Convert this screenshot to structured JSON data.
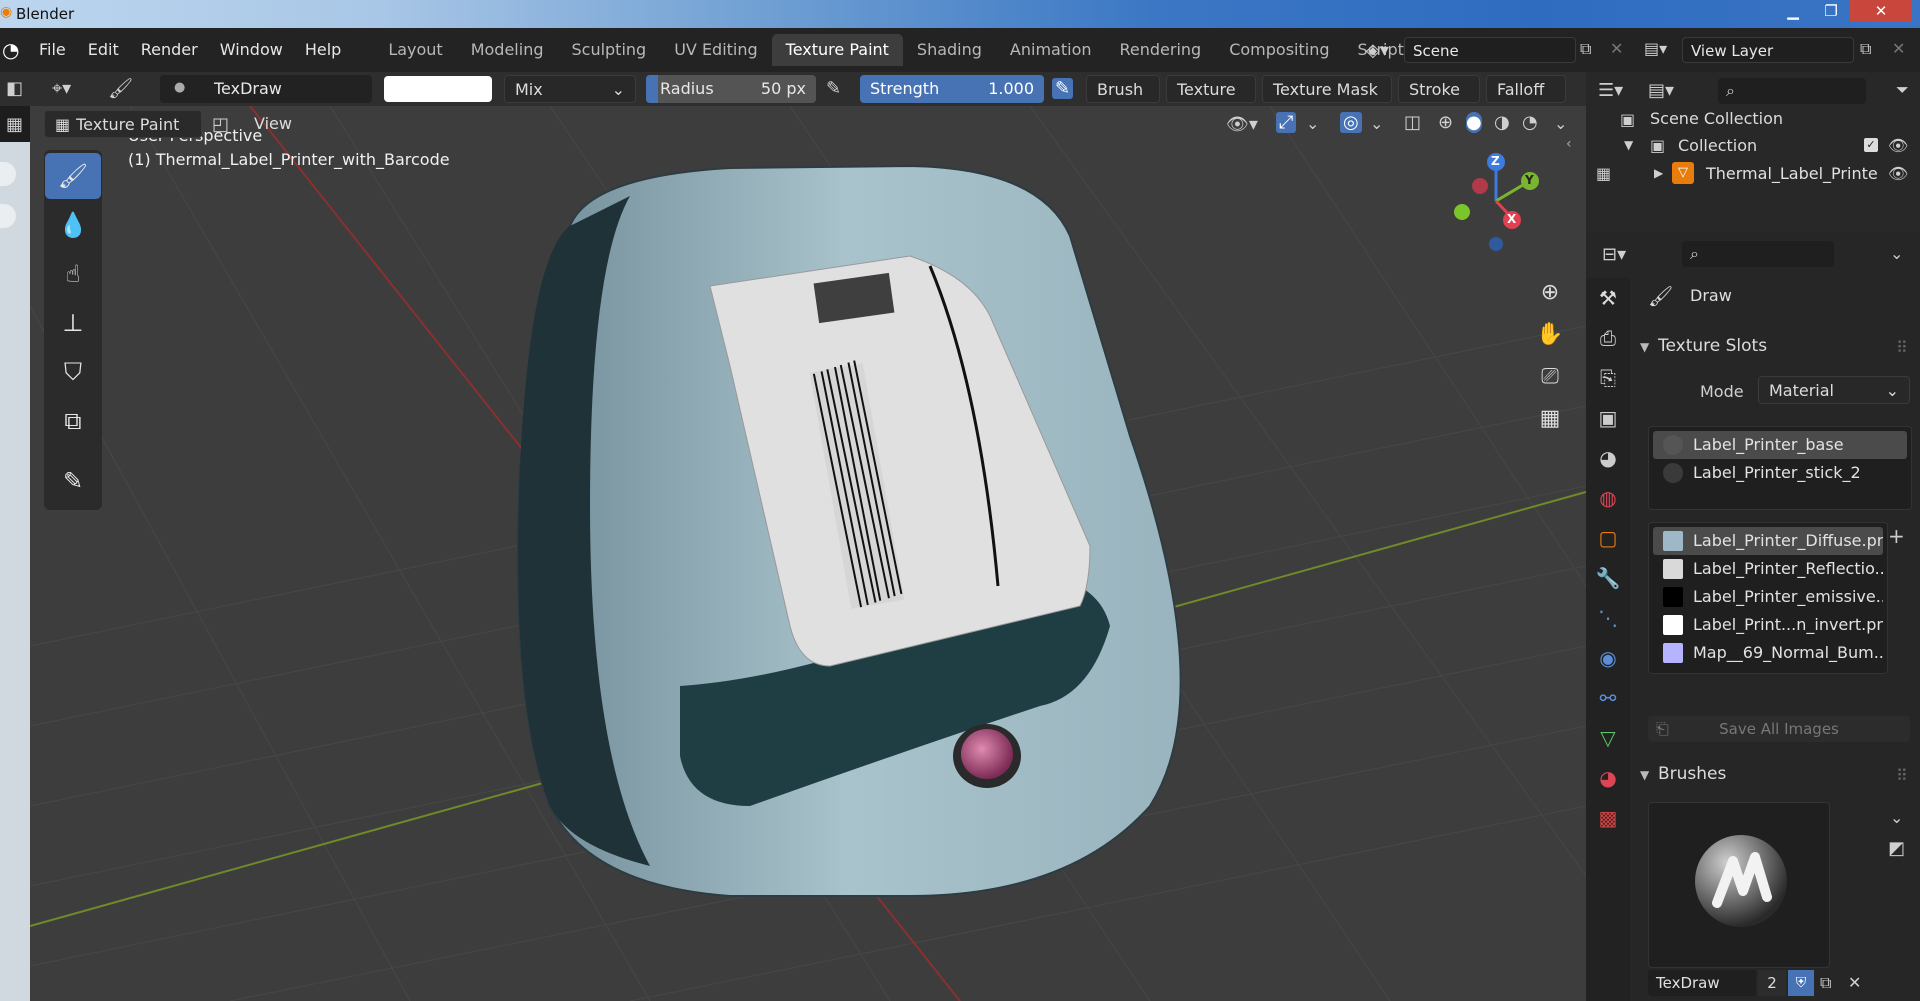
{
  "window": {
    "title": "Blender",
    "minimize": "▁",
    "restore": "❐",
    "close": "✕"
  },
  "menu": {
    "items": [
      "File",
      "Edit",
      "Render",
      "Window",
      "Help"
    ]
  },
  "workspaces": {
    "tabs": [
      "Layout",
      "Modeling",
      "Sculpting",
      "UV Editing",
      "Texture Paint",
      "Shading",
      "Animation",
      "Rendering",
      "Compositing",
      "Scripting"
    ],
    "active": "Texture Paint",
    "add": "+"
  },
  "scene": {
    "label": "Scene",
    "view_layer": "View Layer"
  },
  "tool_header": {
    "brush_name": "TexDraw",
    "blend": "Mix",
    "radius_label": "Radius",
    "radius_value": "50 px",
    "strength_label": "Strength",
    "strength_value": "1.000",
    "menus": [
      "Brush",
      "Texture",
      "Texture Mask",
      "Stroke",
      "Falloff"
    ]
  },
  "mode_header": {
    "mode": "Texture Paint",
    "view": "View"
  },
  "viewport": {
    "perspective": "User Perspective",
    "object": "(1) Thermal_Label_Printer_with_Barcode",
    "axes": {
      "x": "X",
      "y": "Y",
      "z": "Z"
    }
  },
  "outliner": {
    "scene_collection": "Scene Collection",
    "collection": "Collection",
    "object": "Thermal_Label_Printe"
  },
  "properties": {
    "tool_name": "Draw",
    "texture_slots": {
      "title": "Texture Slots",
      "mode_label": "Mode",
      "mode_value": "Material",
      "materials": [
        "Label_Printer_base",
        "Label_Printer_stick_2"
      ],
      "images": [
        {
          "name": "Label_Printer_Diffuse.png",
          "color": "#9fb8c8"
        },
        {
          "name": "Label_Printer_Reflectio...",
          "color": "#d9d9d9"
        },
        {
          "name": "Label_Printer_emissive....",
          "color": "#000000"
        },
        {
          "name": "Label_Print...n_invert.png",
          "color": "#ffffff"
        },
        {
          "name": "Map__69_Normal_Bum...",
          "color": "#b7b4ff"
        }
      ],
      "save_all": "Save All Images"
    },
    "brushes": {
      "title": "Brushes",
      "name": "TexDraw",
      "users": "2"
    }
  },
  "colors": {
    "accent": "#4772b3",
    "active_tab": "#3d3d3d"
  }
}
